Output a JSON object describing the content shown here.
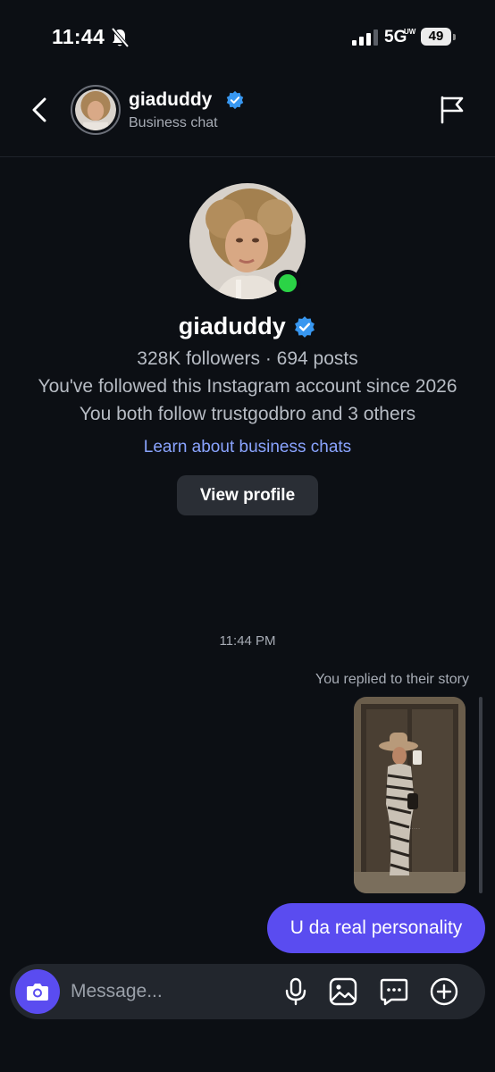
{
  "status_bar": {
    "time": "11:44",
    "network": "5G",
    "network_sub": "UW",
    "battery": "49",
    "icons": [
      "bell-slash-icon",
      "signal-icon"
    ]
  },
  "header": {
    "username": "giaduddy",
    "subtitle": "Business chat",
    "icons": [
      "back-chevron-icon",
      "verified-badge-icon",
      "flag-icon"
    ]
  },
  "profile": {
    "username": "giaduddy",
    "stats": "328K followers · 694 posts",
    "followed_since": "You've followed this Instagram account since 2026",
    "mutual": "You both follow trustgodbro and 3 others",
    "learn_link": "Learn about business chats",
    "view_profile_label": "View profile",
    "online": true
  },
  "chat": {
    "timestamp": "11:44 PM",
    "reply_note": "You replied to their story",
    "messages": [
      {
        "from": "me",
        "type": "story-reply",
        "text": "U da real personality"
      }
    ]
  },
  "composer": {
    "placeholder": "Message...",
    "icons": [
      "camera-icon",
      "microphone-icon",
      "gallery-icon",
      "sticker-icon",
      "add-icon"
    ]
  },
  "colors": {
    "background": "#0c0f14",
    "accent": "#5a4cf0",
    "link": "#8aa4ff",
    "verified": "#3897f0",
    "online": "#2bd346"
  }
}
